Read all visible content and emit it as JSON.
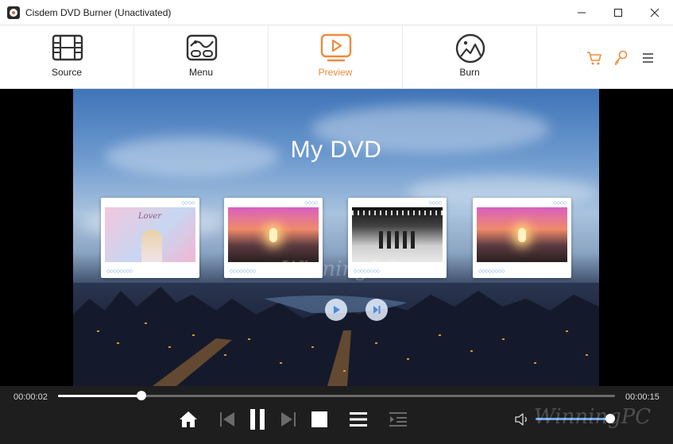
{
  "window": {
    "title": "Cisdem DVD Burner (Unactivated)",
    "controls": [
      "minimize-icon",
      "maximize-icon",
      "close-icon"
    ]
  },
  "toolbar": {
    "tabs": [
      {
        "label": "Source",
        "icon": "film-strip-icon",
        "active": false
      },
      {
        "label": "Menu",
        "icon": "menu-template-icon",
        "active": false
      },
      {
        "label": "Preview",
        "icon": "preview-play-icon",
        "active": true
      },
      {
        "label": "Burn",
        "icon": "disc-burn-icon",
        "active": false
      }
    ],
    "right_icons": [
      "cart-icon",
      "key-icon",
      "hamburger-menu-icon"
    ],
    "accent_color": "#f08a3c"
  },
  "preview": {
    "dvd_title": "My DVD",
    "thumbnails": [
      {
        "caption": "Lover"
      },
      {
        "caption": ""
      },
      {
        "caption": ""
      },
      {
        "caption": ""
      }
    ],
    "watermark": "WinningPC"
  },
  "player": {
    "current_time": "00:00:02",
    "total_time": "00:00:15",
    "progress": 0.15,
    "volume": 1.0,
    "buttons": [
      "home-icon",
      "previous-icon",
      "pause-icon",
      "next-icon",
      "stop-icon",
      "playlist-icon",
      "chapter-icon",
      "volume-icon"
    ],
    "watermark": "WinningPC"
  }
}
